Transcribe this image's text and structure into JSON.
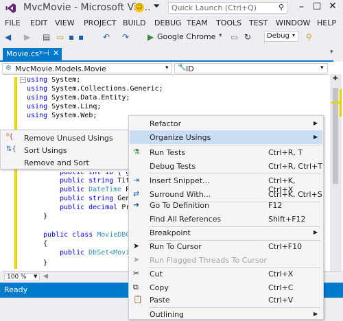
{
  "window": {
    "title": "MvcMovie - Microsoft Vis...",
    "quick_launch_placeholder": "Quick Launch (Ctrl+Q)"
  },
  "menubar": [
    "FILE",
    "EDIT",
    "VIEW",
    "PROJECT",
    "BUILD",
    "DEBUG",
    "TEAM",
    "TOOLS",
    "TEST",
    "WINDOW",
    "HELP"
  ],
  "toolbar": {
    "run_label": "Google Chrome",
    "config_label": "Debug"
  },
  "tab": {
    "label": "Movie.cs*",
    "pin": "⊣",
    "close": "✕"
  },
  "navbar": {
    "left": "MvcMovie.Models.Movie",
    "right": "ID"
  },
  "code": {
    "line1_kw": "using",
    "line1_rest": " System;",
    "line2_kw": "using",
    "line2_rest": " System.Collections.Generic;",
    "line3_kw": "using",
    "line3_rest": " System.Data.Entity;",
    "line4_kw": "using",
    "line4_rest": " System.Linq;",
    "line5_kw": "using",
    "line5_rest": " System.Web;",
    "line6_kw": "public int ID { g",
    "line7_kw": "public",
    "line7_ty": " string",
    "line7_rest": " Tit",
    "line8_kw": "public",
    "line8_ty": " DateTime",
    "line8_rest": " R",
    "line9_kw": "public",
    "line9_ty": " string",
    "line9_rest": " Gen",
    "line10_kw": "public",
    "line10_ty": " decimal",
    "line10_rest": " Pr",
    "line11": "}",
    "line12_kw": "public class",
    "line12_ty": " MovieDBC",
    "line13": "{",
    "line14_kw": "public",
    "line14_ty": " DbSet<Movi",
    "line15": "}"
  },
  "zoom": "100 %",
  "status": "Ready",
  "submenu": [
    {
      "label": "Remove Unused Usings",
      "icon": "remove-usings-icon"
    },
    {
      "label": "Sort Usings",
      "icon": "sort-usings-icon"
    },
    {
      "label": "Remove and Sort",
      "icon": ""
    }
  ],
  "context_menu": {
    "refactor": "Refactor",
    "organize_usings": "Organize Usings",
    "run_tests": {
      "label": "Run Tests",
      "shortcut": "Ctrl+R, T"
    },
    "debug_tests": {
      "label": "Debug Tests",
      "shortcut": "Ctrl+R, Ctrl+T"
    },
    "insert_snippet": {
      "label": "Insert Snippet...",
      "shortcut": "Ctrl+K, Ctrl+X"
    },
    "surround_with": {
      "label": "Surround With...",
      "shortcut": "Ctrl+K, Ctrl+S"
    },
    "go_to_definition": {
      "label": "Go To Definition",
      "shortcut": "F12"
    },
    "find_all_references": {
      "label": "Find All References",
      "shortcut": "Shift+F12"
    },
    "breakpoint": "Breakpoint",
    "run_to_cursor": {
      "label": "Run To Cursor",
      "shortcut": "Ctrl+F10"
    },
    "run_flagged": "Run Flagged Threads To Cursor",
    "cut": {
      "label": "Cut",
      "shortcut": "Ctrl+X"
    },
    "copy": {
      "label": "Copy",
      "shortcut": "Ctrl+C"
    },
    "paste": {
      "label": "Paste",
      "shortcut": "Ctrl+V"
    },
    "outlining": "Outlining"
  },
  "colors": {
    "accent": "#007acc",
    "highlight": "#c9def5",
    "keyword": "#0000ff",
    "type": "#2b91af"
  }
}
